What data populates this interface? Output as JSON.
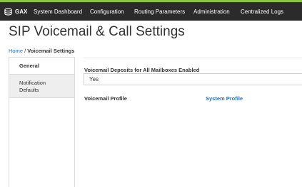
{
  "header": {
    "brand": "GAX",
    "nav": [
      "System Dashboard",
      "Configuration",
      "Routing Parameters",
      "Administration",
      "Centralized Logs"
    ],
    "accent_color": "#8cc63f",
    "background_color": "#2b2b2b"
  },
  "page": {
    "title": "SIP Voicemail & Call Settings"
  },
  "breadcrumb": {
    "home": "Home",
    "separator": "/",
    "current": "Voicemail Settings"
  },
  "tabs": {
    "general": "General",
    "notification_line1": "Notification",
    "notification_line2": "Defaults"
  },
  "form": {
    "deposits_label": "Voicemail Deposits for All Mailboxes Enabled",
    "deposits_value": "Yes",
    "profile_label": "Voicemail Profile",
    "profile_link": "System Profile"
  },
  "colors": {
    "link": "#2a6ebb"
  }
}
